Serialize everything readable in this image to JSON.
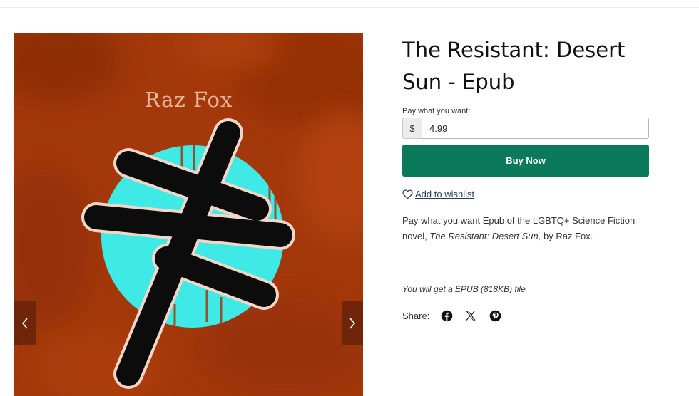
{
  "product": {
    "title": "The Resistant: Desert Sun - Epub",
    "cover_author": "Raz Fox",
    "pay_label": "Pay what you want:",
    "currency_symbol": "$",
    "price_value": "4.99",
    "buy_label": "Buy Now",
    "wishlist_label": "Add to wishlist",
    "description_part1": "Pay what you want Epub of the LGBTQ+ Science Fiction novel, ",
    "description_italic": "The Resistant: Desert Sun,",
    "description_part2": " by Raz Fox.",
    "file_note": "You will get a EPUB (818KB) file",
    "share_label": "Share:",
    "share_icons": [
      "facebook-icon",
      "x-icon",
      "pinterest-icon"
    ]
  },
  "gallery": {
    "prev_icon": "chevron-left-icon",
    "next_icon": "chevron-right-icon"
  },
  "colors": {
    "buy_button": "#0b7a5b",
    "cover_background": "#a3380a",
    "cover_circle": "#3ee9e6",
    "link": "#2b3a5a"
  }
}
